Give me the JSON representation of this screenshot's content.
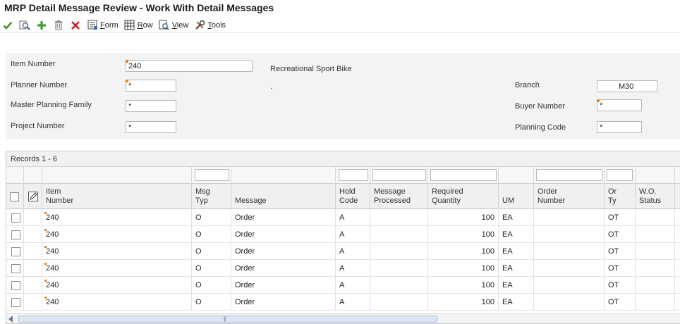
{
  "window": {
    "title": "MRP Detail Message Review - Work With Detail Messages"
  },
  "toolbar": {
    "ok_icon": "checkmark-icon",
    "find_icon": "search-icon",
    "add_icon": "plus-icon",
    "delete_icon": "trash-icon",
    "cancel_icon": "close-icon",
    "form_label_u": "F",
    "form_label_rest": "orm",
    "row_label_u": "R",
    "row_label_rest": "ow",
    "view_label_u": "V",
    "view_label_rest": "iew",
    "tools_label_u": "T",
    "tools_label_rest": "ools"
  },
  "header": {
    "item_number_label": "Item Number",
    "item_number_value": "240",
    "item_description": "Recreational Sport Bike",
    "planner_number_label": "Planner Number",
    "planner_number_value": "*",
    "planner_description": ".",
    "master_planning_family_label": "Master Planning Family",
    "master_planning_family_value": "*",
    "project_number_label": "Project Number",
    "project_number_value": "*",
    "branch_label": "Branch",
    "branch_value": "M30",
    "buyer_number_label": "Buyer Number",
    "buyer_number_value": "*",
    "planning_code_label": "Planning Code",
    "planning_code_value": "*"
  },
  "grid": {
    "records_label": "Records 1 - 6",
    "columns": {
      "item_number_1": "Item",
      "item_number_2": "Number",
      "msg_typ_1": "Msg",
      "msg_typ_2": "Typ",
      "message": "Message",
      "hold_code_1": "Hold",
      "hold_code_2": "Code",
      "message_processed_1": "Message",
      "message_processed_2": "Processed",
      "required_quantity_1": "Required",
      "required_quantity_2": "Quantity",
      "um": "UM",
      "order_number_1": "Order",
      "order_number_2": "Number",
      "or_ty_1": "Or",
      "or_ty_2": "Ty",
      "wo_status_1": "W.O.",
      "wo_status_2": "Status"
    },
    "rows": [
      {
        "item": "240",
        "msg_typ": "O",
        "message": "Order",
        "hold": "A",
        "processed": "",
        "qty": "100",
        "um": "EA",
        "order_no": "",
        "or_ty": "OT",
        "wo_status": ""
      },
      {
        "item": "240",
        "msg_typ": "O",
        "message": "Order",
        "hold": "A",
        "processed": "",
        "qty": "100",
        "um": "EA",
        "order_no": "",
        "or_ty": "OT",
        "wo_status": ""
      },
      {
        "item": "240",
        "msg_typ": "O",
        "message": "Order",
        "hold": "A",
        "processed": "",
        "qty": "100",
        "um": "EA",
        "order_no": "",
        "or_ty": "OT",
        "wo_status": ""
      },
      {
        "item": "240",
        "msg_typ": "O",
        "message": "Order",
        "hold": "A",
        "processed": "",
        "qty": "100",
        "um": "EA",
        "order_no": "",
        "or_ty": "OT",
        "wo_status": ""
      },
      {
        "item": "240",
        "msg_typ": "O",
        "message": "Order",
        "hold": "A",
        "processed": "",
        "qty": "100",
        "um": "EA",
        "order_no": "",
        "or_ty": "OT",
        "wo_status": ""
      },
      {
        "item": "240",
        "msg_typ": "O",
        "message": "Order",
        "hold": "A",
        "processed": "",
        "qty": "100",
        "um": "EA",
        "order_no": "",
        "or_ty": "OT",
        "wo_status": ""
      }
    ]
  },
  "colors": {
    "required_flag": "#f07d1e",
    "ok_green": "#3a8a1e",
    "add_green": "#2f9a2a",
    "cancel_red": "#cc2222"
  }
}
